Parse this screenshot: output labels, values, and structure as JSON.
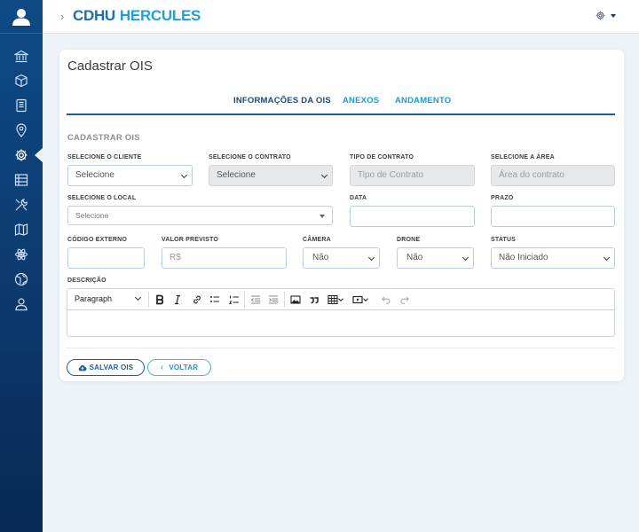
{
  "brand": {
    "part1": "CDHU",
    "part2": "HERCULES"
  },
  "sidebar": {
    "items": [
      {
        "icon": "bank-icon"
      },
      {
        "icon": "cube-icon"
      },
      {
        "icon": "book-icon"
      },
      {
        "icon": "map-pin-icon"
      },
      {
        "icon": "gear-icon",
        "active": true
      },
      {
        "icon": "list-icon"
      },
      {
        "icon": "tools-icon"
      },
      {
        "icon": "map-icon"
      },
      {
        "icon": "atom-icon"
      },
      {
        "icon": "globe-icon"
      },
      {
        "icon": "user-icon"
      }
    ]
  },
  "page": {
    "title": "Cadastrar OIS",
    "tabs": [
      {
        "label": "INFORMAÇÕES DA OIS",
        "active": true
      },
      {
        "label": "ANEXOS",
        "active": false
      },
      {
        "label": "ANDAMENTO",
        "active": false
      }
    ],
    "section_title": "CADASTRAR OIS"
  },
  "form": {
    "cliente": {
      "label": "SELECIONE O CLIENTE",
      "value": "Selecione"
    },
    "contrato": {
      "label": "SELECIONE O CONTRATO",
      "value": "Selecione"
    },
    "tipo_contrato": {
      "label": "TIPO DE CONTRATO",
      "placeholder": "Tipo de Contrato"
    },
    "area": {
      "label": "SELECIONE A ÁREA",
      "placeholder": "Área do contrato"
    },
    "local": {
      "label": "SELECIONE O LOCAL",
      "value": "Selecione"
    },
    "data": {
      "label": "DATA",
      "value": ""
    },
    "prazo": {
      "label": "PRAZO",
      "value": ""
    },
    "codigo_externo": {
      "label": "CÓDIGO EXTERNO",
      "value": ""
    },
    "valor_previsto": {
      "label": "VALOR PREVISTO",
      "placeholder": "R$"
    },
    "camera": {
      "label": "CÂMERA",
      "value": "Não"
    },
    "drone": {
      "label": "DRONE",
      "value": "Não"
    },
    "status": {
      "label": "STATUS",
      "value": "Não Iniciado"
    },
    "descricao": {
      "label": "DESCRIÇÃO",
      "format": "Paragraph"
    }
  },
  "buttons": {
    "save": "SALVAR OIS",
    "back": "VOLTAR"
  },
  "colors": {
    "sidebar": "#0b3b70",
    "primary": "#1e5e9c",
    "accent": "#1fa0d8"
  }
}
